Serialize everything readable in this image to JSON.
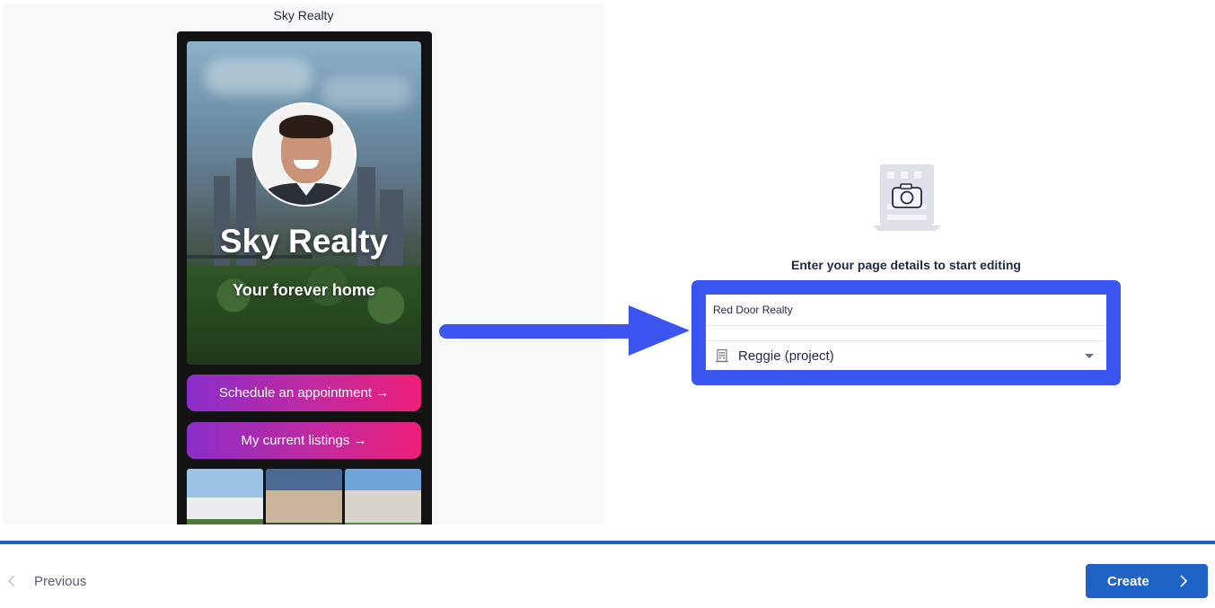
{
  "preview": {
    "title": "Sky Realty",
    "hero_title": "Sky Realty",
    "hero_subtitle": "Your forever home",
    "buttons": [
      {
        "label": "Schedule an appointment →"
      },
      {
        "label": "My current listings →"
      }
    ],
    "gradient_colors": [
      "#8a2ec9",
      "#ef1f7a"
    ]
  },
  "form": {
    "heading": "Enter your page details to start editing",
    "name_value": "Red Door Realty",
    "project_selected": "Reggie (project)",
    "project_icon": "building-icon",
    "illustration_icon": "camera-building-icon"
  },
  "footer": {
    "previous_label": "Previous",
    "create_label": "Create"
  },
  "colors": {
    "accent": "#3a55f0",
    "primary": "#1e63c5"
  }
}
